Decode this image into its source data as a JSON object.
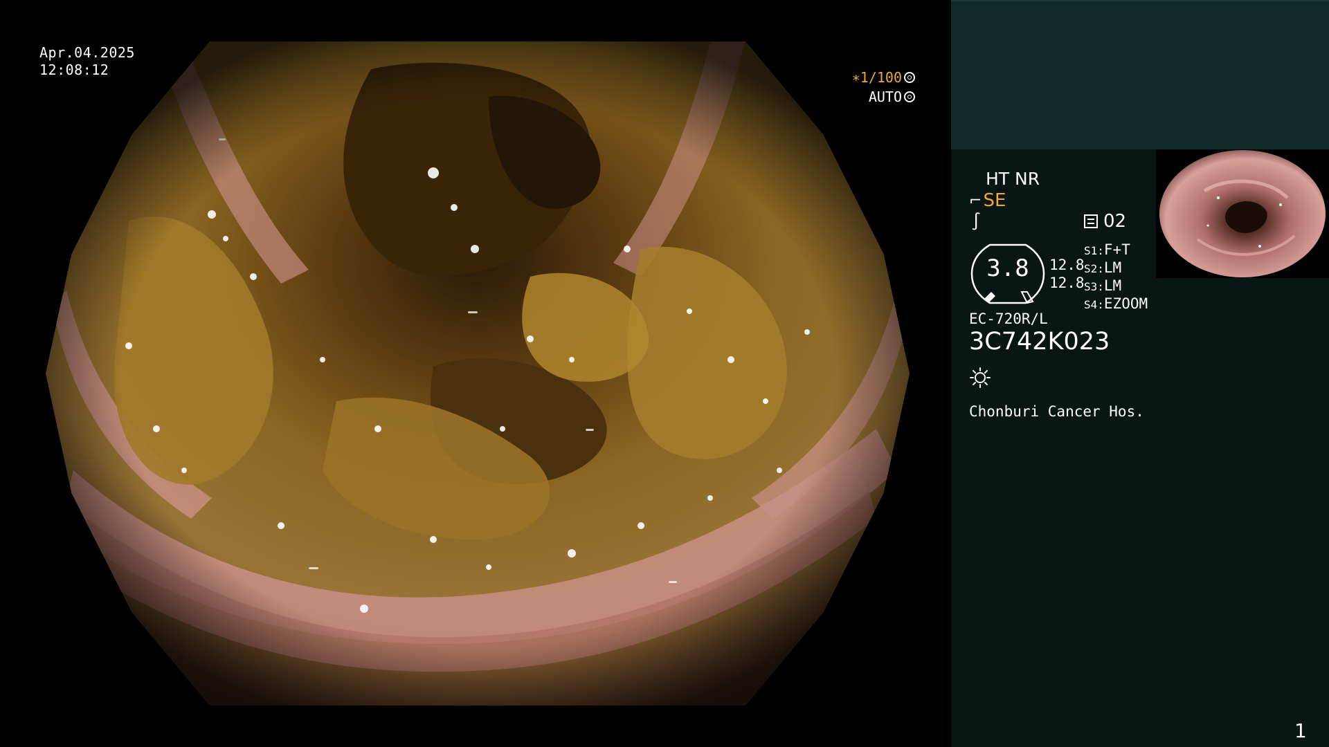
{
  "overlay": {
    "date": "Apr.04.2025",
    "time": "12:08:12",
    "shutter_speed": "∗1/100",
    "exposure_mode": "AUTO"
  },
  "status": {
    "enhancement": "HT NR",
    "structure_mode": "SE",
    "filter_number": "02",
    "gauge_value": "3.8",
    "gauge_nums": [
      "12.8",
      "12.8"
    ],
    "memory_slots": [
      {
        "slot": "S1:",
        "value": "F+T"
      },
      {
        "slot": "S2:",
        "value": "LM"
      },
      {
        "slot": "S3:",
        "value": "LM"
      },
      {
        "slot": "S4:",
        "value": "EZOOM"
      }
    ],
    "scope_model": "EC-720R/L",
    "serial_number": "3C742K023",
    "hospital": "Chonburi Cancer Hos."
  },
  "page_number": "1",
  "colors": {
    "accent": "#f0a830",
    "panel_top": "#102a28",
    "panel_body": "#081615"
  },
  "icons": {
    "shutter": "aperture-icon",
    "auto": "iris-icon",
    "structure": "hook-icon",
    "color": "curve-icon",
    "filter": "list-icon",
    "light": "light-source-icon"
  }
}
